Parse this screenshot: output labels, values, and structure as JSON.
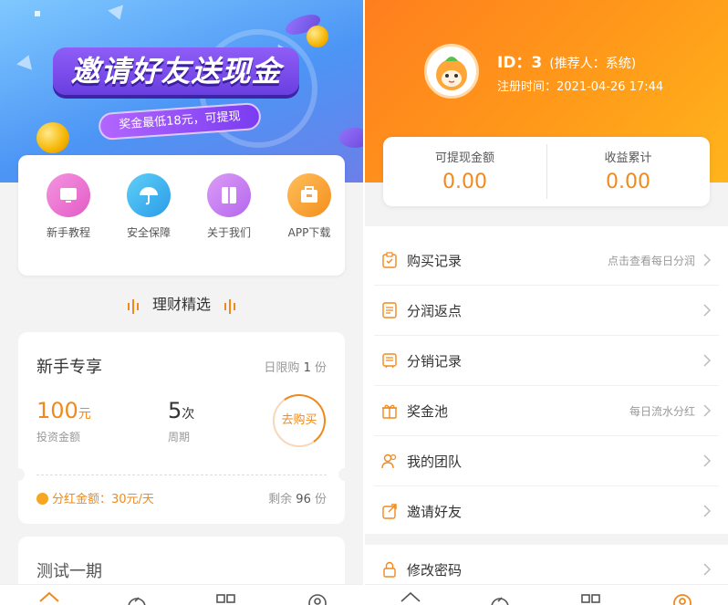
{
  "left_screen": {
    "banner": {
      "title": "邀请好友送现金",
      "subtitle": "奖金最低18元，可提现"
    },
    "quick_links": [
      {
        "label": "新手教程",
        "icon": "monitor-icon",
        "color": "#e96fd0"
      },
      {
        "label": "安全保障",
        "icon": "umbrella-icon",
        "color": "#3fb2ef"
      },
      {
        "label": "关于我们",
        "icon": "book-icon",
        "color": "#c57cf2"
      },
      {
        "label": "APP下载",
        "icon": "download-box-icon",
        "color": "#f7a23a"
      }
    ],
    "section_title": "理财精选",
    "products": [
      {
        "name": "新手专享",
        "limit_prefix": "日限购",
        "limit_value": "1",
        "limit_unit": "份",
        "amount_value": "100",
        "amount_unit": "元",
        "amount_label": "投资金额",
        "period_value": "5",
        "period_unit": "次",
        "period_label": "周期",
        "buy_label": "去购买",
        "bonus_text": "分红金额：30元/天",
        "remain_prefix": "剩余",
        "remain_value": "96",
        "remain_unit": "份"
      },
      {
        "name": "测试一期"
      }
    ]
  },
  "right_screen": {
    "profile": {
      "id_text": "ID：3",
      "referrer_text": "(推荐人：系统)",
      "register_text": "注册时间：2021-04-26 17:44"
    },
    "balance": {
      "withdrawable_label": "可提现金额",
      "withdrawable_value": "0.00",
      "earnings_label": "收益累计",
      "earnings_value": "0.00"
    },
    "menu": [
      {
        "label": "购买记录",
        "hint": "点击查看每日分润",
        "icon": "clipboard-icon"
      },
      {
        "label": "分润返点",
        "hint": "",
        "icon": "document-icon"
      },
      {
        "label": "分销记录",
        "hint": "",
        "icon": "list-doc-icon"
      },
      {
        "label": "奖金池",
        "hint": "每日流水分红",
        "icon": "gift-box-icon"
      },
      {
        "label": "我的团队",
        "hint": "",
        "icon": "team-icon"
      },
      {
        "label": "邀请好友",
        "hint": "",
        "icon": "share-icon"
      }
    ],
    "menu_secondary": [
      {
        "label": "修改密码",
        "hint": "",
        "icon": "lock-icon"
      }
    ]
  },
  "tabbar_icons": [
    "home-icon",
    "finance-icon",
    "grid-icon",
    "user-icon"
  ],
  "colors": {
    "accent_orange": "#f08a1d",
    "header_orange": "#ff8c1c",
    "banner_blue": "#4c95f5"
  }
}
